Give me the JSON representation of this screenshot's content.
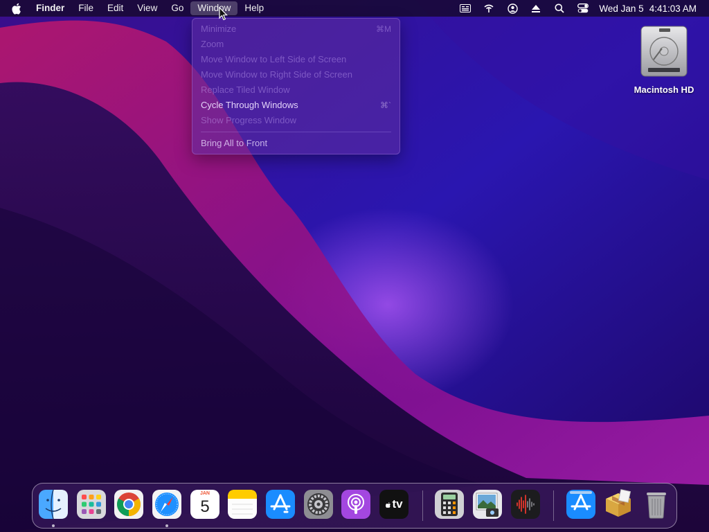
{
  "menubar": {
    "app_name": "Finder",
    "menus": [
      "File",
      "Edit",
      "View",
      "Go",
      "Window",
      "Help"
    ],
    "active_menu": "Window",
    "status_icons": [
      "keyboard-input-icon",
      "wifi-icon",
      "user-account-icon",
      "eject-icon",
      "search-icon",
      "control-center-icon"
    ],
    "date": "Wed Jan 5",
    "time": "4:41:03 AM"
  },
  "window_menu": {
    "items": [
      {
        "label": "Minimize",
        "shortcut": "⌘M",
        "enabled": false
      },
      {
        "label": "Zoom",
        "shortcut": "",
        "enabled": false
      },
      {
        "label": "Move Window to Left Side of Screen",
        "shortcut": "",
        "enabled": false
      },
      {
        "label": "Move Window to Right Side of Screen",
        "shortcut": "",
        "enabled": false
      },
      {
        "label": "Replace Tiled Window",
        "shortcut": "",
        "enabled": false
      },
      {
        "label": "Cycle Through Windows",
        "shortcut": "⌘`",
        "enabled": true
      },
      {
        "label": "Show Progress Window",
        "shortcut": "",
        "enabled": false
      },
      {
        "label": "Bring All to Front",
        "shortcut": "",
        "enabled": true
      }
    ]
  },
  "desktop": {
    "disk_label": "Macintosh HD"
  },
  "dock": {
    "apps": [
      {
        "name": "finder-icon",
        "running": true
      },
      {
        "name": "launchpad-icon",
        "running": false
      },
      {
        "name": "chrome-icon",
        "running": false
      },
      {
        "name": "safari-icon",
        "running": true
      },
      {
        "name": "calendar-icon",
        "running": false,
        "month": "JAN",
        "day": "5"
      },
      {
        "name": "notes-icon",
        "running": false
      },
      {
        "name": "app-store-icon",
        "running": false
      },
      {
        "name": "system-preferences-icon",
        "running": false
      },
      {
        "name": "podcasts-icon",
        "running": false
      },
      {
        "name": "apple-tv-icon",
        "running": false,
        "text": "tv"
      },
      {
        "name": "calculator-icon",
        "running": false
      },
      {
        "name": "preview-icon",
        "running": false
      },
      {
        "name": "voice-memos-icon",
        "running": false
      },
      {
        "name": "app-store-downloads-icon",
        "running": false
      },
      {
        "name": "installer-package-icon",
        "running": false
      },
      {
        "name": "trash-icon",
        "running": false
      }
    ]
  },
  "colors": {
    "accent_menu_bg": "#5f2da0",
    "wallpaper_base": "#2a0a6e",
    "wallpaper_magenta": "#b0108a"
  }
}
